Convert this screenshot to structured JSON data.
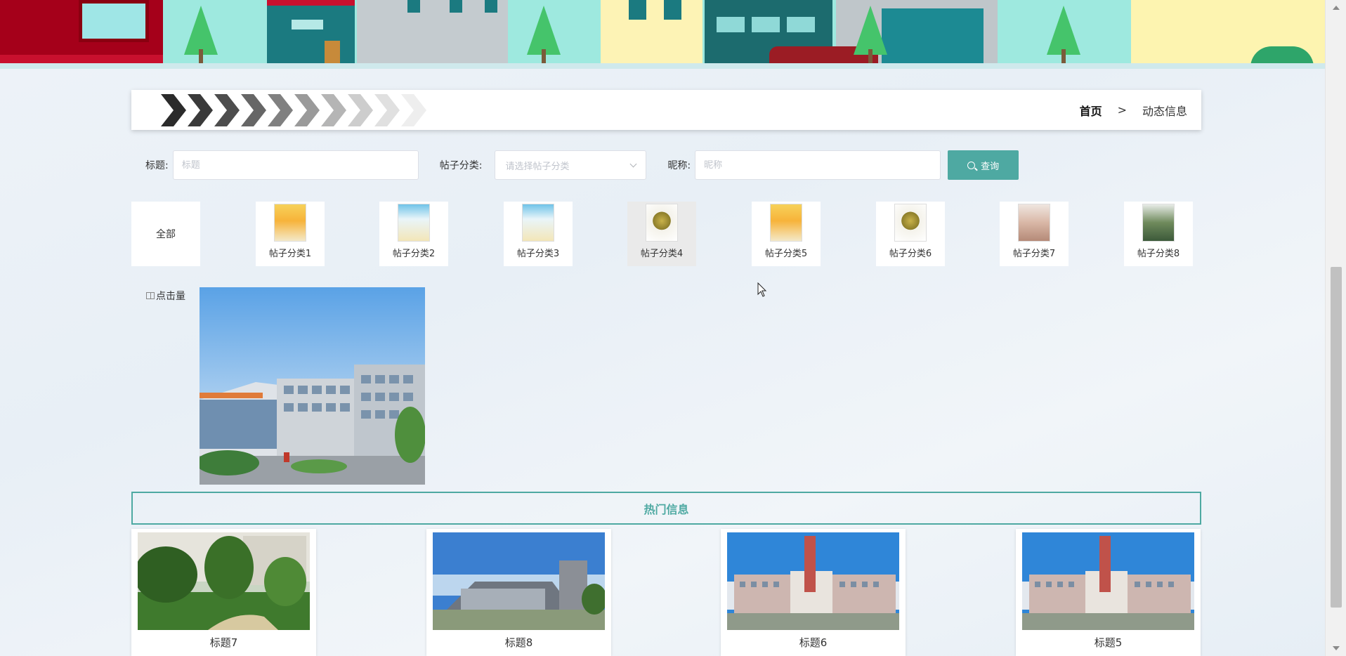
{
  "breadcrumb": {
    "home": "首页",
    "separator": ">",
    "current": "动态信息"
  },
  "search": {
    "title_label": "标题:",
    "title_placeholder": "标题",
    "category_label": "帖子分类:",
    "category_placeholder": "请选择帖子分类",
    "nickname_label": "昵称:",
    "nickname_placeholder": "昵称",
    "query_button": "查询"
  },
  "categories": {
    "all": "全部",
    "items": [
      {
        "label": "帖子分类1"
      },
      {
        "label": "帖子分类2"
      },
      {
        "label": "帖子分类3"
      },
      {
        "label": "帖子分类4",
        "active": true
      },
      {
        "label": "帖子分类5"
      },
      {
        "label": "帖子分类6"
      },
      {
        "label": "帖子分类7"
      },
      {
        "label": "帖子分类8"
      }
    ]
  },
  "sort": {
    "label": "点击量"
  },
  "hot": {
    "title": "热门信息",
    "cards": [
      {
        "title": "标题7"
      },
      {
        "title": "标题8"
      },
      {
        "title": "标题6"
      },
      {
        "title": "标题5"
      }
    ]
  },
  "colors": {
    "accent": "#4ea9a2",
    "banner_bg": "#9ee9df"
  }
}
